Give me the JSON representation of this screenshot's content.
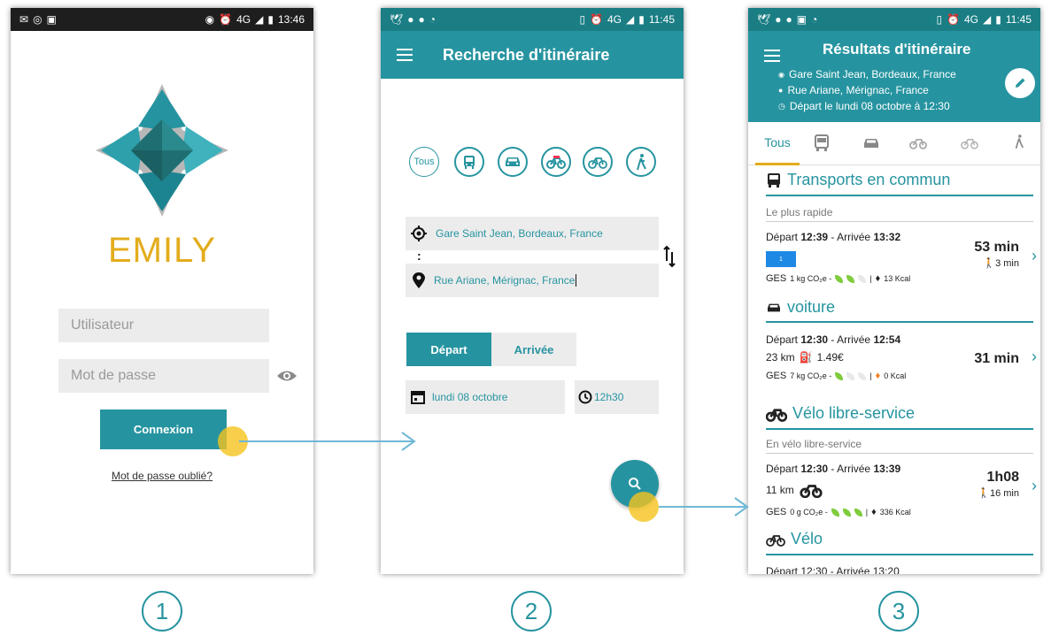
{
  "screen1": {
    "status": {
      "time": "13:46",
      "network": "4G"
    },
    "app_name": "EMILY",
    "username_placeholder": "Utilisateur",
    "password_placeholder": "Mot de passe",
    "login_button": "Connexion",
    "forgot_link": "Mot de passe oublié?"
  },
  "screen2": {
    "status": {
      "time": "11:45",
      "network": "4G"
    },
    "title": "Recherche d'itinéraire",
    "modes": [
      "Tous",
      "bus",
      "voiture",
      "vélo libre-service",
      "vélo",
      "marche"
    ],
    "origin": "Gare Saint Jean, Bordeaux, France",
    "separator": ":",
    "destination": "Rue Ariane, Mérignac, France",
    "tab_depart": "Départ",
    "tab_arrivee": "Arrivée",
    "date": "lundi 08 octobre",
    "time": "12h30"
  },
  "screen3": {
    "status": {
      "time": "11:45",
      "network": "4G"
    },
    "title": "Résultats d'itinéraire",
    "summary_origin": "Gare Saint Jean, Bordeaux, France",
    "summary_destination": "Rue Ariane, Mérignac, France",
    "summary_departure": "Départ le lundi 08 octobre  à  12:30",
    "tab_all": "Tous",
    "sections": {
      "transit": {
        "title": "Transports en commun",
        "subtitle": "Le plus rapide",
        "dep_label": "Départ",
        "dep_time": "12:39",
        "arr_label": "- Arrivée",
        "arr_time": "13:32",
        "duration": "53  min",
        "walk": "3 min",
        "line_badge": "1",
        "ges_label": "GES",
        "co2": "1 kg CO₂e -",
        "kcal": "13 Kcal"
      },
      "car": {
        "title": "voiture",
        "dep_label": "Départ",
        "dep_time": "12:30",
        "arr_label": " - Arrivée",
        "arr_time": "12:54",
        "distance": "23 km",
        "cost": "1.49€",
        "duration": "31 min",
        "ges_label": "GES",
        "co2": "7 kg  CO₂e -",
        "kcal": "0 Kcal"
      },
      "bikeshare": {
        "title": "Vélo libre-service",
        "subtitle": "En vélo libre-service",
        "dep_label": "Départ",
        "dep_time": "12:30",
        "arr_label": "- Arrivée",
        "arr_time": "13:39",
        "distance": "11 km",
        "duration": "1h08",
        "walk": "16 min",
        "ges_label": "GES",
        "co2": "0 g CO₂e -",
        "kcal": "336 Kcal"
      },
      "bike": {
        "title": "Vélo",
        "partial": "Départ 12:30  - Arrivée 13:20"
      }
    }
  },
  "steps": [
    "1",
    "2",
    "3"
  ],
  "colors": {
    "teal": "#2694a0",
    "dark_teal": "#1a7e84",
    "gold": "#e3ac1c",
    "arrow": "#6fb8d6"
  }
}
